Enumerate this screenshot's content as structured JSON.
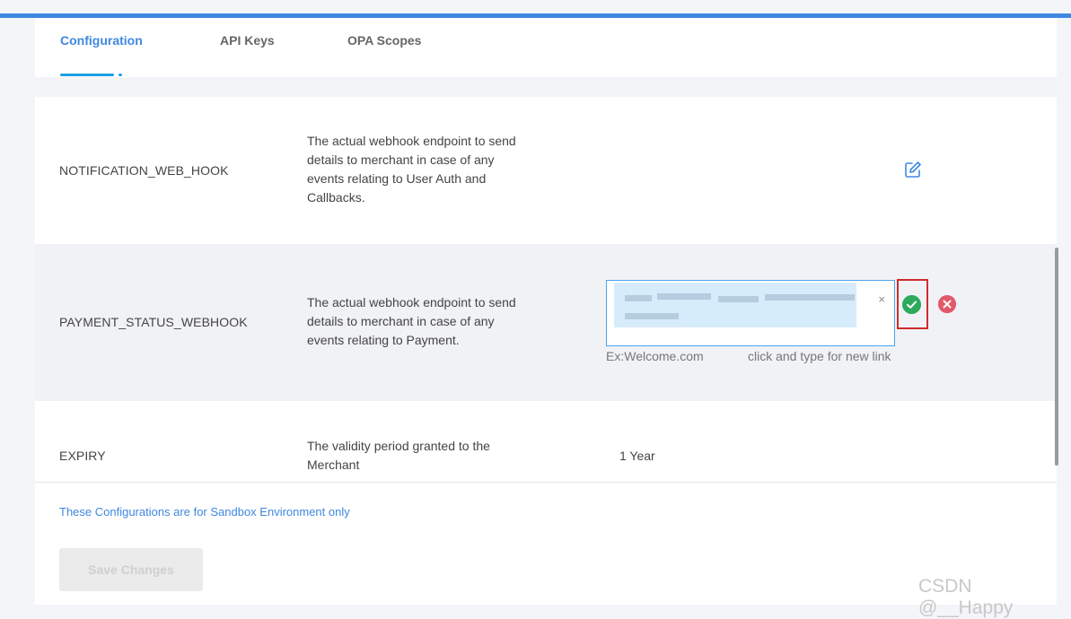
{
  "tabs": [
    {
      "label": "Configuration",
      "active": true
    },
    {
      "label": "API Keys",
      "active": false
    },
    {
      "label": "OPA Scopes",
      "active": false
    }
  ],
  "rows": [
    {
      "name": "NOTIFICATION_WEB_HOOK",
      "description": "The actual webhook endpoint to send details to merchant in case of any events relating to User Auth and Callbacks.",
      "action_icon": "edit-icon"
    },
    {
      "name": "PAYMENT_STATUS_WEBHOOK",
      "description": "The actual webhook endpoint to send details to merchant in case of any events relating to Payment.",
      "input_clear": "×",
      "hint_example": "Ex:Welcome.com",
      "hint_action": "click and type for new link",
      "confirm_icon": "check-circle-icon",
      "cancel_icon": "close-circle-icon"
    },
    {
      "name": "EXPIRY",
      "description": "The validity period granted to the Merchant",
      "value": "1 Year"
    }
  ],
  "footer": {
    "note": "These Configurations are for Sandbox Environment only",
    "save_label": "Save Changes"
  },
  "watermark": "CSDN @__Happy",
  "colors": {
    "accent": "#3f88e0",
    "confirm": "#2eaa5d",
    "cancel": "#e2596a",
    "highlight_border": "#d02c2c"
  }
}
